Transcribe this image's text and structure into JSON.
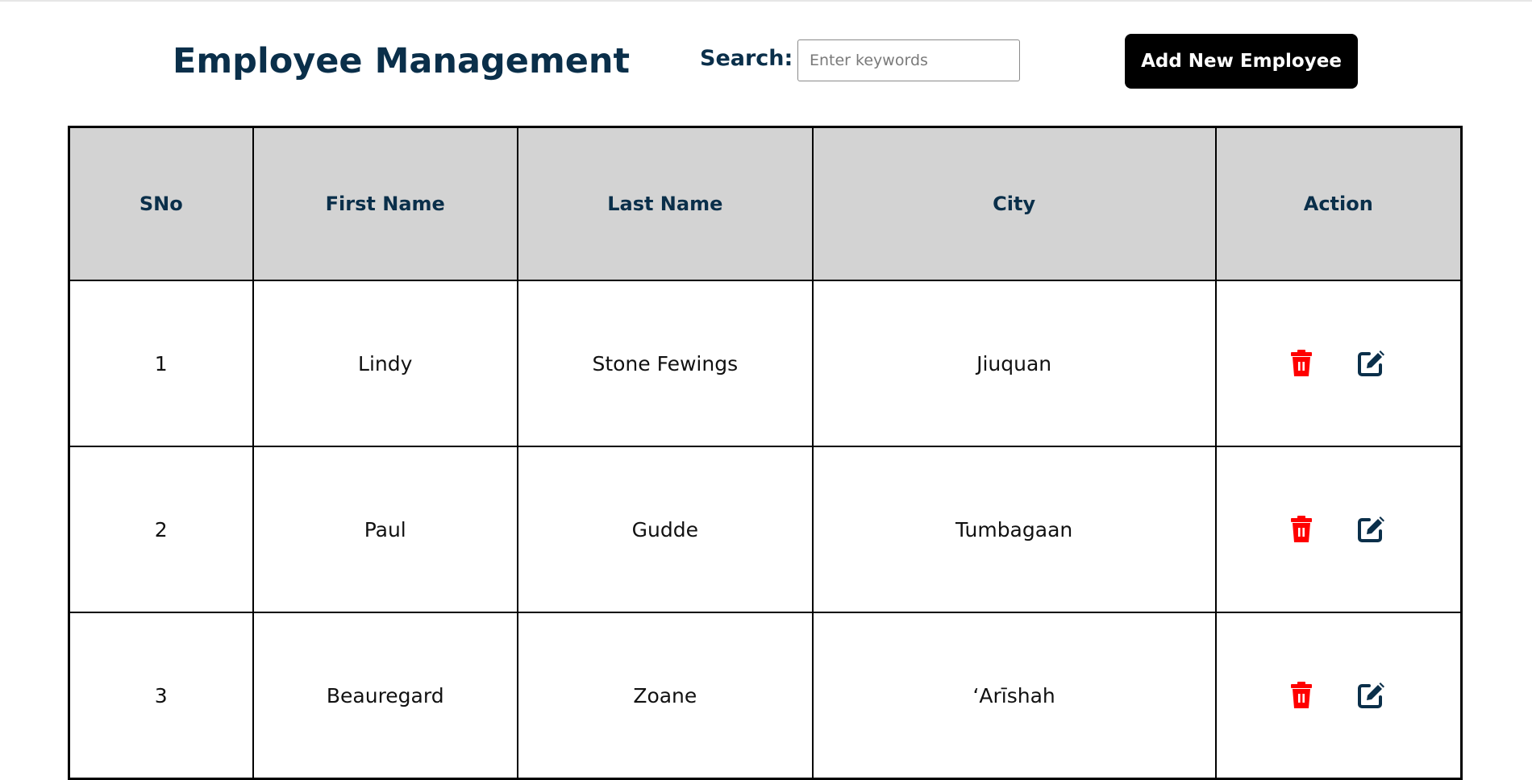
{
  "header": {
    "title": "Employee Management",
    "search_label": "Search:",
    "search_placeholder": "Enter keywords",
    "search_value": "",
    "add_button_label": "Add New Employee"
  },
  "table": {
    "columns": [
      "SNo",
      "First Name",
      "Last Name",
      "City",
      "Action"
    ],
    "rows": [
      {
        "sno": "1",
        "first_name": "Lindy",
        "last_name": "Stone Fewings",
        "city": "Jiuquan"
      },
      {
        "sno": "2",
        "first_name": "Paul",
        "last_name": "Gudde",
        "city": "Tumbagaan"
      },
      {
        "sno": "3",
        "first_name": "Beauregard",
        "last_name": "Zoane",
        "city": "‘Arīshah"
      }
    ]
  },
  "icons": {
    "delete": "trash-icon",
    "edit": "edit-icon"
  },
  "colors": {
    "title": "#0a2f4a",
    "header_bg": "#d3d3d3",
    "delete_icon": "#ff0000",
    "edit_icon": "#0a2f4a",
    "button_bg": "#000000"
  }
}
